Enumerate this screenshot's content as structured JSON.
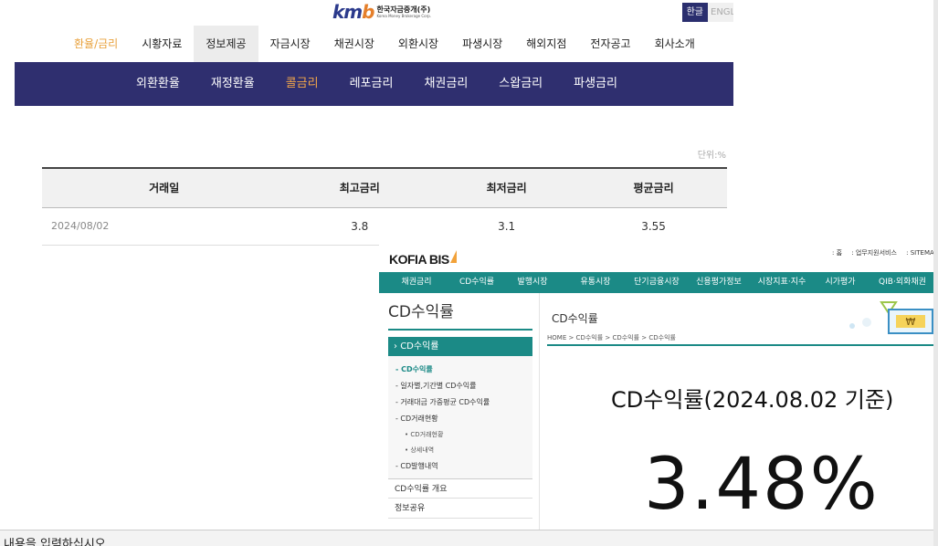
{
  "kmb": {
    "logo_mark_main": "km",
    "logo_mark_accent": "b",
    "logo_ko": "한국자금중개(주)",
    "logo_en": "Korea Money Brokerage Corp.",
    "lang": {
      "ko": "한글",
      "en": "ENGL"
    },
    "nav": [
      "환율/금리",
      "시황자료",
      "정보제공",
      "자금시장",
      "채권시장",
      "외환시장",
      "파생시장",
      "해외지점",
      "전자공고",
      "회사소개"
    ],
    "subnav": [
      "외환환율",
      "재정환율",
      "콜금리",
      "레포금리",
      "채권금리",
      "스왑금리",
      "파생금리"
    ],
    "unit": "단위:%",
    "table": {
      "headers": [
        "거래일",
        "최고금리",
        "최저금리",
        "평균금리"
      ],
      "rows": [
        [
          "2024/08/02",
          "3.8",
          "3.1",
          "3.55"
        ]
      ]
    }
  },
  "kofia": {
    "logo": "KOFIA BIS",
    "util": [
      ": 홈",
      ": 업무지원서비스",
      ": SITEMAP"
    ],
    "nav": [
      "채권금리",
      "CD수익률",
      "발행시장",
      "유통시장",
      "단기금융시장",
      "신용평가정보",
      "시장지표·지수",
      "시가평가",
      "QIB·외화채권"
    ],
    "left_title": "CD수익률",
    "left_selected": "CD수익률",
    "left_sub": [
      {
        "label": "- CD수익률",
        "level": 1,
        "current": true
      },
      {
        "label": "- 일자별,기간별 CD수익률",
        "level": 1
      },
      {
        "label": "- 거래대금 가중평균 CD수익률",
        "level": 1
      },
      {
        "label": "- CD거래현황",
        "level": 1
      },
      {
        "label": "• CD거래현황",
        "level": 2
      },
      {
        "label": "• 상세내역",
        "level": 2
      },
      {
        "label": "- CD발행내역",
        "level": 1
      }
    ],
    "left_links": [
      "CD수익률 개요",
      "정보공유"
    ],
    "page_title": "CD수익률",
    "breadcrumb": "HOME > CD수익률 > CD수익률 > CD수익률",
    "deco_symbol": "₩",
    "headline": "CD수익률(2024.08.02 기준)",
    "big_value": "3.48%"
  },
  "bottom_text": "내용을 입력하십시오."
}
